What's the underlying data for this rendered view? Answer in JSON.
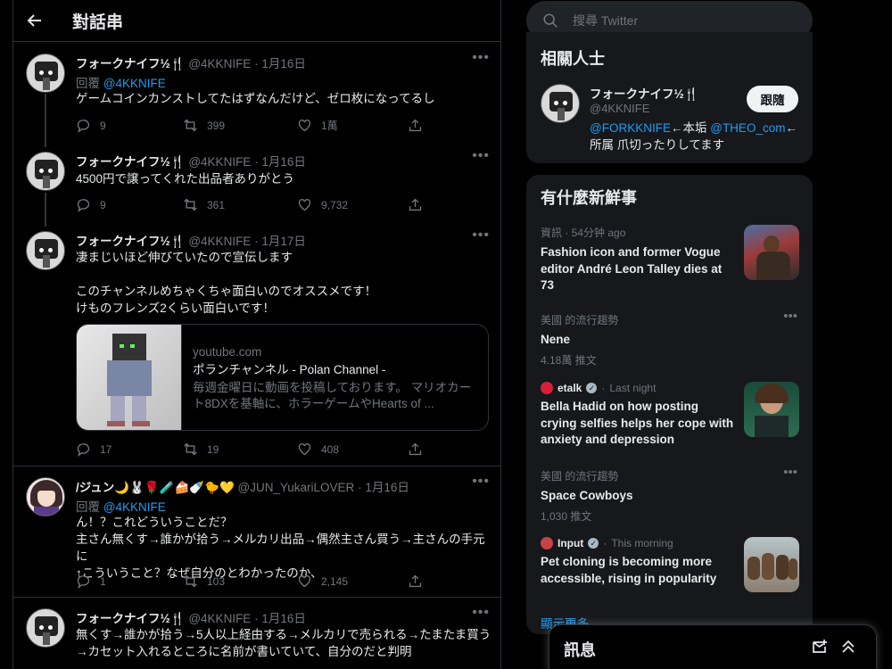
{
  "header": {
    "back_icon": "back-arrow-icon",
    "title": "對話串"
  },
  "tweets": [
    {
      "name": "フォークナイフ½🍴",
      "handle": "@4KKNIFE",
      "dot": "·",
      "date": "1月16日",
      "reply_prefix": "回覆",
      "reply_to": "@4KKNIFE",
      "text": "ゲームコインカンストしてたはずなんだけど、ゼロ枚になってるし",
      "replies": "9",
      "retweets": "399",
      "likes": "1萬"
    },
    {
      "name": "フォークナイフ½🍴",
      "handle": "@4KKNIFE",
      "dot": "·",
      "date": "1月16日",
      "text": "4500円で譲ってくれた出品者ありがとう",
      "replies": "9",
      "retweets": "361",
      "likes": "9,732"
    },
    {
      "name": "フォークナイフ½🍴",
      "handle": "@4KKNIFE",
      "dot": "·",
      "date": "1月17日",
      "text": "凄まじいほど伸びていたので宣伝します\n\nこのチャンネルめちゃくちゃ面白いのでオススメです！\nけものフレンズ2くらい面白いです！",
      "card": {
        "domain": "youtube.com",
        "title": "ポランチャンネル - Polan Channel -",
        "description": "毎週金曜日に動画を投稿しております。 マリオカート8DXを基軸に、ホラーゲームやHearts of ..."
      },
      "replies": "17",
      "retweets": "19",
      "likes": "408"
    },
    {
      "name": "/ジュン🌙🐰🌹🧪🍰🍼🐤💛",
      "handle": "@JUN_YukariLOVER",
      "dot": "·",
      "date": "1月16日",
      "reply_prefix": "回覆",
      "reply_to": "@4KKNIFE",
      "text": "ん！？これどういうことだ？\n主さん無くす→誰かが拾う→メルカリ出品→偶然主さん買う→主さんの手元に\n↑こういうこと？なぜ自分のとわかったのか、",
      "replies": "1",
      "retweets": "103",
      "likes": "2,145"
    },
    {
      "name": "フォークナイフ½🍴",
      "handle": "@4KKNIFE",
      "dot": "·",
      "date": "1月16日",
      "text": "無くす→誰かが拾う→5人以上経由する→メルカリで売られる→たまたま買う→カセット入れるところに名前が書いていて、自分のだと判明"
    }
  ],
  "search": {
    "placeholder": "搜尋 Twitter",
    "value": ""
  },
  "related": {
    "title": "相關人士",
    "name": "フォークナイフ½🍴",
    "handle": "@4KKNIFE",
    "follow_label": "跟隨",
    "bio_mention1": "@FORKKNIFE",
    "bio_text1": "←本垢 ",
    "bio_mention2": "@THEO_com",
    "bio_text2": "←所属 爪切ったりしてます"
  },
  "trends": {
    "title": "有什麼新鮮事",
    "items": [
      {
        "meta": "資訊 · 54分钟 ago",
        "headline": "Fashion icon and former Vogue editor André Leon Talley dies at 73",
        "image": "fashion-photo"
      },
      {
        "meta": "美國 的流行趨勢",
        "headline": "Nene",
        "count": "4.18萬 推文"
      },
      {
        "source": "etalk",
        "meta": "Last night",
        "headline": "Bella Hadid on how posting crying selfies helps her cope with anxiety and depression",
        "image": "bella-photo"
      },
      {
        "meta": "美國 的流行趨勢",
        "headline": "Space Cowboys",
        "count": "1,030 推文"
      },
      {
        "source": "Input",
        "meta": "This morning",
        "headline": "Pet cloning is becoming more accessible, rising in popularity",
        "image": "dogs-photo"
      }
    ],
    "show_more": "顯示更多"
  },
  "messages": {
    "title": "訊息"
  },
  "colors": {
    "accent": "#1d9bf0",
    "background": "#000000",
    "panel": "#16181c",
    "muted": "#71767b",
    "text": "#e7e9ea"
  }
}
